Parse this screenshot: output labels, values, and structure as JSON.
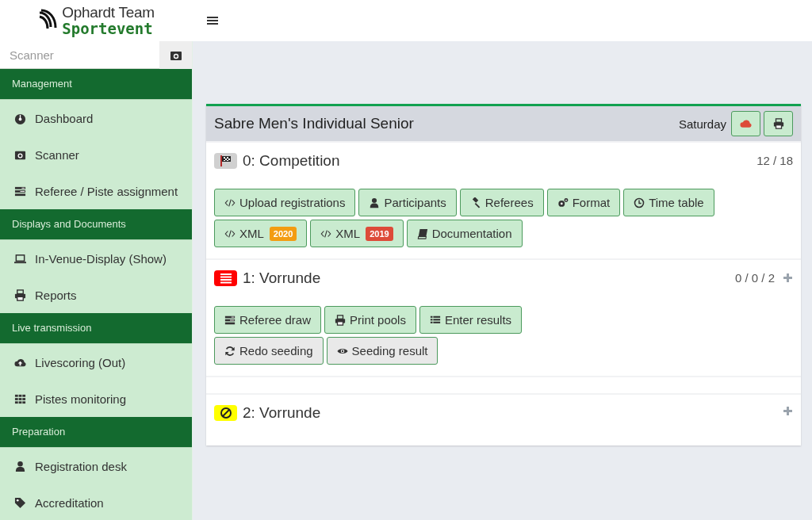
{
  "header": {
    "logo_top": "Ophardt Team",
    "logo_bottom": "Sportevent"
  },
  "sidebar": {
    "scanner": {
      "placeholder": "Scanner"
    },
    "sections": [
      {
        "title": "Management",
        "items": [
          {
            "label": "Dashboard",
            "kind": "gauge"
          },
          {
            "label": "Scanner",
            "kind": "camera"
          },
          {
            "label": "Referee / Piste assignment",
            "kind": "bars"
          }
        ]
      },
      {
        "title": "Displays and Documents",
        "items": [
          {
            "label": "In-Venue-Display (Show)",
            "kind": "laptop"
          },
          {
            "label": "Reports",
            "kind": "print"
          }
        ]
      },
      {
        "title": "Live transmission",
        "items": [
          {
            "label": "Livescoring (Out)",
            "kind": "cloud"
          },
          {
            "label": "Pistes monitoring",
            "kind": "grid"
          }
        ]
      },
      {
        "title": "Preparation",
        "items": [
          {
            "label": "Registration desk",
            "kind": "user"
          },
          {
            "label": "Accreditation",
            "kind": "tag"
          }
        ]
      }
    ]
  },
  "card": {
    "title": "Sabre Men's Individual Senior",
    "day": "Saturday",
    "stages": [
      {
        "kind": "flag",
        "title": "0: Competition",
        "count": "12 / 18",
        "expandable": false,
        "button_rows": [
          [
            {
              "label": "Upload registrations",
              "kind": "code",
              "secondary": false
            },
            {
              "label": "Participants",
              "kind": "user",
              "secondary": false
            },
            {
              "label": "Referees",
              "kind": "gavel",
              "secondary": false
            },
            {
              "label": "Format",
              "kind": "cogs",
              "secondary": false
            },
            {
              "label": "Time table",
              "kind": "clock",
              "secondary": false
            }
          ],
          [
            {
              "label": "XML",
              "kind": "code",
              "secondary": false,
              "tag": {
                "text": "2020",
                "color": "#f39c12"
              }
            },
            {
              "label": "XML",
              "kind": "code",
              "secondary": false,
              "tag": {
                "text": "2019",
                "color": "#dd4b39"
              }
            },
            {
              "label": "Documentation",
              "kind": "book",
              "secondary": false
            }
          ]
        ]
      },
      {
        "kind": "list",
        "title": "1: Vorrunde",
        "count": "0 / 0 / 2",
        "expandable": true,
        "button_rows": [
          [
            {
              "label": "Referee draw",
              "kind": "bars",
              "secondary": false
            },
            {
              "label": "Print pools",
              "kind": "print",
              "secondary": false
            },
            {
              "label": "Enter results",
              "kind": "list",
              "secondary": false
            }
          ],
          [
            {
              "label": "Redo seeding",
              "kind": "refresh",
              "secondary": true
            },
            {
              "label": "Seeding result",
              "kind": "eye",
              "secondary": true
            }
          ]
        ]
      },
      {
        "kind": "ban",
        "title": "2: Vorrunde",
        "expandable": true
      }
    ]
  }
}
